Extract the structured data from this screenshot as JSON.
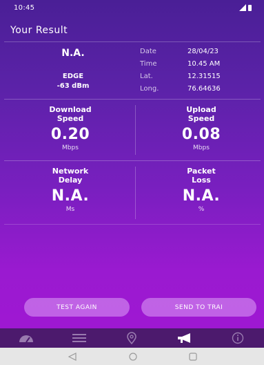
{
  "status_bar": {
    "time": "10:45"
  },
  "header": {
    "title": "Your Result"
  },
  "info": {
    "network_type": "N.A.",
    "network_label": "EDGE",
    "signal_strength": "-63 dBm",
    "date_label": "Date",
    "date_value": "28/04/23",
    "time_label": "Time",
    "time_value": "10.45 AM",
    "lat_label": "Lat.",
    "lat_value": "12.31515",
    "long_label": "Long.",
    "long_value": "76.64636"
  },
  "metrics": {
    "download": {
      "label_line1": "Download",
      "label_line2": "Speed",
      "value": "0.20",
      "unit": "Mbps"
    },
    "upload": {
      "label_line1": "Upload",
      "label_line2": "Speed",
      "value": "0.08",
      "unit": "Mbps"
    },
    "delay": {
      "label_line1": "Network",
      "label_line2": "Delay",
      "value": "N.A.",
      "unit": "Ms"
    },
    "loss": {
      "label_line1": "Packet",
      "label_line2": "Loss",
      "value": "N.A.",
      "unit": "%"
    }
  },
  "actions": {
    "test_again": "TEST AGAIN",
    "send": "SEND TO TRAI"
  },
  "bottom_nav": [
    "speedometer-icon",
    "list-icon",
    "location-pin-icon",
    "megaphone-icon",
    "info-icon"
  ],
  "colors": {
    "gradient_top": "#4a1f96",
    "gradient_bottom": "#a017d3",
    "nav_bg": "#4c1a6d",
    "button_bg": "#dca0f5"
  }
}
